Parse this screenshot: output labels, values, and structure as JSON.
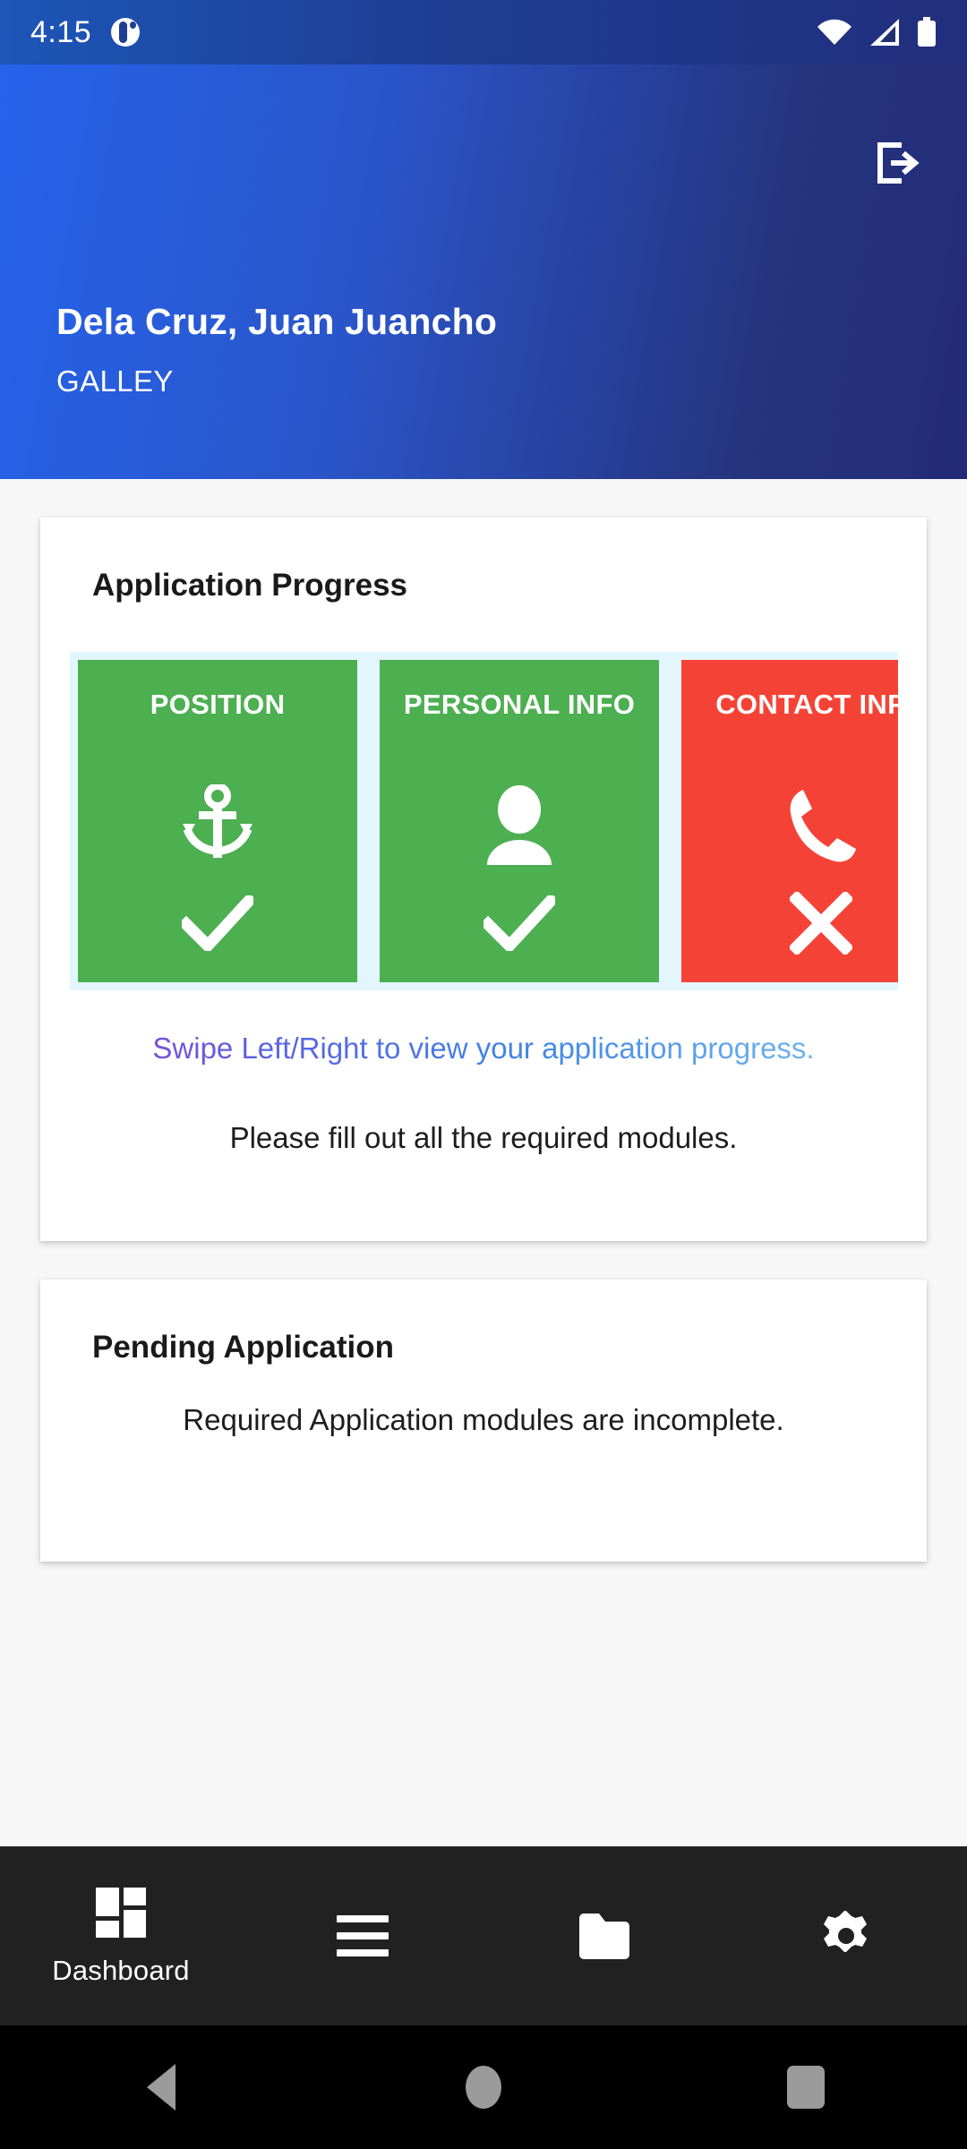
{
  "status_bar": {
    "time": "4:15",
    "app_icon": "app-notification-icon",
    "icons": [
      "wifi-icon",
      "cellular-signal-icon",
      "battery-icon"
    ]
  },
  "header": {
    "logout_icon": "logout-icon",
    "user_name": "Dela Cruz, Juan Juancho",
    "user_department": "GALLEY",
    "gradient_from": "#2563EB",
    "gradient_to": "#232B78"
  },
  "progress_card": {
    "title": "Application Progress",
    "carousel_bg": "#E3F6FD",
    "tiles": [
      {
        "label": "POSITION",
        "icon": "anchor-icon",
        "status": "check-icon",
        "status_state": "complete",
        "color": "#4CAF50"
      },
      {
        "label": "PERSONAL INFO",
        "icon": "person-icon",
        "status": "check-icon",
        "status_state": "complete",
        "color": "#4CAF50"
      },
      {
        "label": "CONTACT INFO",
        "icon": "phone-icon",
        "status": "cross-icon",
        "status_state": "incomplete",
        "color": "#F44336"
      }
    ],
    "swipe_hint": "Swipe Left/Right to view your application progress.",
    "instruction": "Please fill out all the required modules."
  },
  "pending_card": {
    "title": "Pending Application",
    "message": "Required Application modules are incomplete."
  },
  "bottom_nav": {
    "items": [
      {
        "label": "Dashboard",
        "icon": "dashboard-grid-icon",
        "active": true
      },
      {
        "label": "",
        "icon": "menu-hamburger-icon",
        "active": false
      },
      {
        "label": "",
        "icon": "folder-icon",
        "active": false
      },
      {
        "label": "",
        "icon": "gear-icon",
        "active": false
      }
    ]
  },
  "android_nav": {
    "back": "back-triangle-icon",
    "home": "home-circle-icon",
    "recents": "recents-square-icon"
  }
}
